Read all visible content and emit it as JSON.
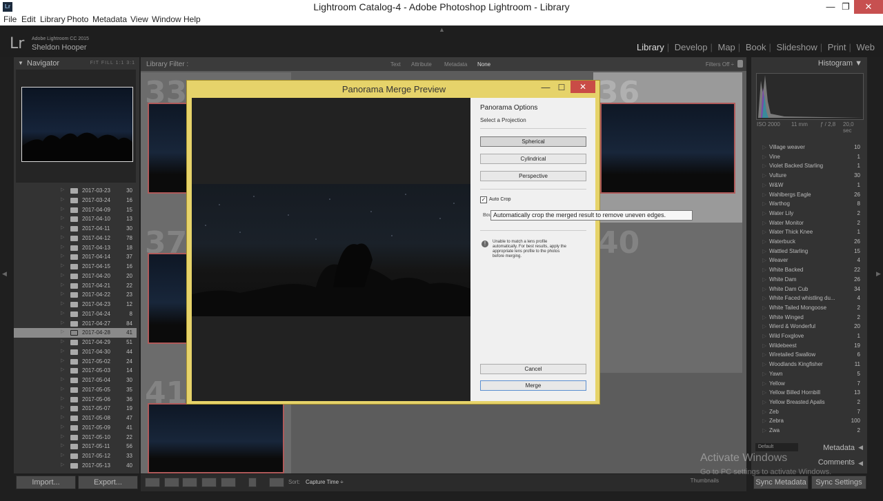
{
  "window": {
    "title": "Lightroom Catalog-4 - Adobe Photoshop Lightroom - Library",
    "app_icon": "Lr",
    "min": "—",
    "max": "❐",
    "close": "✕"
  },
  "menu": [
    "File",
    "Edit",
    "Library",
    "Photo",
    "Metadata",
    "View",
    "Window",
    "Help"
  ],
  "identity": {
    "logo": "Lr",
    "version": "Adobe Lightroom CC 2015",
    "user": "Sheldon Hooper"
  },
  "modules": [
    "Library",
    "Develop",
    "Map",
    "Book",
    "Slideshow",
    "Print",
    "Web"
  ],
  "navigator": {
    "title": "Navigator",
    "options": "FIT   FILL   1:1   3:1"
  },
  "folders": [
    {
      "name": "2017-03-23",
      "count": "30"
    },
    {
      "name": "2017-03-24",
      "count": "16"
    },
    {
      "name": "2017-04-09",
      "count": "15"
    },
    {
      "name": "2017-04-10",
      "count": "13"
    },
    {
      "name": "2017-04-11",
      "count": "30"
    },
    {
      "name": "2017-04-12",
      "count": "78"
    },
    {
      "name": "2017-04-13",
      "count": "18"
    },
    {
      "name": "2017-04-14",
      "count": "37"
    },
    {
      "name": "2017-04-15",
      "count": "16"
    },
    {
      "name": "2017-04-20",
      "count": "20"
    },
    {
      "name": "2017-04-21",
      "count": "22"
    },
    {
      "name": "2017-04-22",
      "count": "23"
    },
    {
      "name": "2017-04-23",
      "count": "12"
    },
    {
      "name": "2017-04-24",
      "count": "8"
    },
    {
      "name": "2017-04-27",
      "count": "84"
    },
    {
      "name": "2017-04-28",
      "count": "41"
    },
    {
      "name": "2017-04-29",
      "count": "51"
    },
    {
      "name": "2017-04-30",
      "count": "44"
    },
    {
      "name": "2017-05-02",
      "count": "24"
    },
    {
      "name": "2017-05-03",
      "count": "14"
    },
    {
      "name": "2017-05-04",
      "count": "30"
    },
    {
      "name": "2017-05-05",
      "count": "35"
    },
    {
      "name": "2017-05-06",
      "count": "36"
    },
    {
      "name": "2017-05-07",
      "count": "19"
    },
    {
      "name": "2017-05-08",
      "count": "47"
    },
    {
      "name": "2017-05-09",
      "count": "41"
    },
    {
      "name": "2017-05-10",
      "count": "22"
    },
    {
      "name": "2017-05-11",
      "count": "56"
    },
    {
      "name": "2017-05-12",
      "count": "33"
    },
    {
      "name": "2017-05-13",
      "count": "40"
    }
  ],
  "selected_folder": "2017-04-28",
  "buttons": {
    "import": "Import...",
    "export": "Export...",
    "sync_metadata": "Sync Metadata",
    "sync_settings": "Sync Settings"
  },
  "filter": {
    "label": "Library Filter :",
    "tabs": [
      "Text",
      "Attribute",
      "Metadata",
      "None"
    ],
    "status": "Filters Off ÷"
  },
  "grid_numbers": [
    "33",
    "36",
    "37",
    "40",
    "41"
  ],
  "histogram": {
    "title": "Histogram",
    "iso": "ISO 2000",
    "focal": "11 mm",
    "aperture": "ƒ / 2,8",
    "shutter": "20,0 sec"
  },
  "keywords": [
    {
      "name": "Village weaver",
      "count": "10"
    },
    {
      "name": "Vine",
      "count": "1"
    },
    {
      "name": "Violet Backed Starling",
      "count": "1"
    },
    {
      "name": "Vulture",
      "count": "30"
    },
    {
      "name": "W&W",
      "count": "1"
    },
    {
      "name": "Wahlbergs Eagle",
      "count": "26"
    },
    {
      "name": "Warthog",
      "count": "8"
    },
    {
      "name": "Water Lily",
      "count": "2"
    },
    {
      "name": "Water Monitor",
      "count": "2"
    },
    {
      "name": "Water Thick Knee",
      "count": "1"
    },
    {
      "name": "Waterbuck",
      "count": "26"
    },
    {
      "name": "Wattled Starling",
      "count": "15"
    },
    {
      "name": "Weaver",
      "count": "4"
    },
    {
      "name": "White Backed",
      "count": "22"
    },
    {
      "name": "White Dam",
      "count": "26"
    },
    {
      "name": "White Dam Cub",
      "count": "34"
    },
    {
      "name": "White Faced whistling du...",
      "count": "4"
    },
    {
      "name": "White Tailed Mongoose",
      "count": "2"
    },
    {
      "name": "White Winged",
      "count": "2"
    },
    {
      "name": "Wierd & Wonderful",
      "count": "20"
    },
    {
      "name": "Wild Foxglove",
      "count": "1"
    },
    {
      "name": "Wildebeest",
      "count": "19"
    },
    {
      "name": "Wiretailed Swallow",
      "count": "6"
    },
    {
      "name": "Woodlands Kingfisher",
      "count": "11"
    },
    {
      "name": "Yawn",
      "count": "5"
    },
    {
      "name": "Yellow",
      "count": "7"
    },
    {
      "name": "Yellow Billed Hornbill",
      "count": "13"
    },
    {
      "name": "Yellow Breasted Apalis",
      "count": "2"
    },
    {
      "name": "Zeb",
      "count": "7"
    },
    {
      "name": "Zebra",
      "count": "100"
    },
    {
      "name": "Zwa",
      "count": "2"
    }
  ],
  "metadata": {
    "preset": "Default",
    "label": "Metadata",
    "comments": "Comments"
  },
  "toolbar": {
    "sort_label": "Sort:",
    "sort_value": "Capture Time ÷",
    "thumbnails": "Thumbnails"
  },
  "watermark": {
    "line1": "Activate Windows",
    "line2": "Go to PC settings to activate Windows."
  },
  "dialog": {
    "title": "Panorama Merge Preview",
    "min": "—",
    "max": "☐",
    "close": "✕",
    "options_title": "Panorama Options",
    "projection_label": "Select a Projection",
    "projections": [
      "Spherical",
      "Cylindrical",
      "Perspective"
    ],
    "selected_projection": "Spherical",
    "auto_crop_label": "Auto Crop",
    "auto_crop_checked": true,
    "boundary_partial": "Bou",
    "warning": "Unable to match a lens profile automatically. For best results, apply the appropriate lens profile to the photos before merging.",
    "cancel": "Cancel",
    "merge": "Merge",
    "tooltip": "Automatically crop the merged result to remove uneven edges."
  },
  "colors": {
    "dialog_frame": "#e6d36a",
    "close_red": "#c94c46",
    "thumb_border": "#b05a5a"
  }
}
